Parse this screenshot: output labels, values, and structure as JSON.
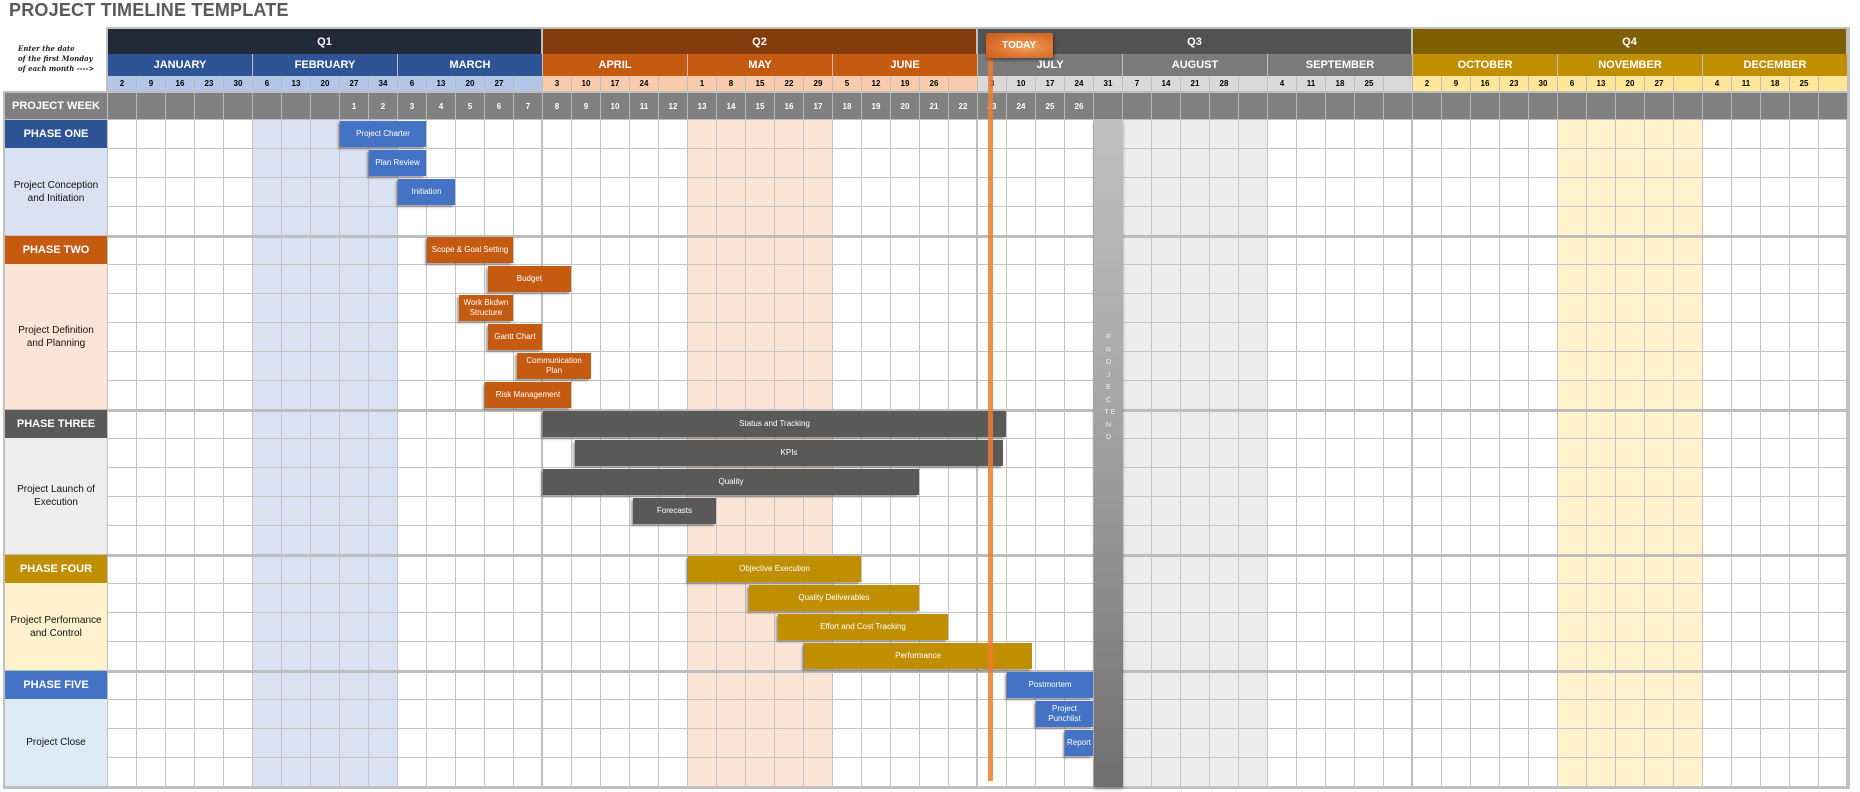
{
  "title": "PROJECT TIMELINE TEMPLATE",
  "note": "Enter the date\nof the first Monday\nof each month ---->",
  "project_week_label": "PROJECT WEEK",
  "today_label": "TODAY",
  "today_week_index": 30.4,
  "project_end_label": "PROJECT END",
  "project_end_week_index": 34,
  "quarters": [
    {
      "label": "Q1",
      "dark": "#222a38",
      "month_color": "#2f5496",
      "date_color": "#b4c6e7",
      "shade": "#dae1f2",
      "shade_month": 1,
      "months": [
        {
          "label": "JANUARY",
          "dates": [
            "2",
            "9",
            "16",
            "23",
            "30"
          ]
        },
        {
          "label": "FEBRUARY",
          "dates": [
            "6",
            "13",
            "20",
            "27",
            "34"
          ]
        },
        {
          "label": "MARCH",
          "dates": [
            "6",
            "13",
            "20",
            "27",
            ""
          ]
        }
      ]
    },
    {
      "label": "Q2",
      "dark": "#843c0c",
      "month_color": "#c55a11",
      "date_color": "#f8cbad",
      "shade": "#fce4d6",
      "shade_month": 1,
      "months": [
        {
          "label": "APRIL",
          "dates": [
            "3",
            "10",
            "17",
            "24",
            ""
          ]
        },
        {
          "label": "MAY",
          "dates": [
            "1",
            "8",
            "15",
            "22",
            "29"
          ]
        },
        {
          "label": "JUNE",
          "dates": [
            "5",
            "12",
            "19",
            "26",
            ""
          ]
        }
      ]
    },
    {
      "label": "Q3",
      "dark": "#525252",
      "month_color": "#7b7b7b",
      "date_color": "#d9d9d9",
      "shade": "#ececec",
      "shade_month": 1,
      "months": [
        {
          "label": "JULY",
          "dates": [
            "3",
            "10",
            "17",
            "24",
            "31"
          ]
        },
        {
          "label": "AUGUST",
          "dates": [
            "7",
            "14",
            "21",
            "28",
            ""
          ]
        },
        {
          "label": "SEPTEMBER",
          "dates": [
            "4",
            "11",
            "18",
            "25",
            ""
          ]
        }
      ]
    },
    {
      "label": "Q4",
      "dark": "#7f6000",
      "month_color": "#bf8f00",
      "date_color": "#ffe699",
      "shade": "#fff2cc",
      "shade_month": 1,
      "months": [
        {
          "label": "OCTOBER",
          "dates": [
            "2",
            "9",
            "16",
            "23",
            "30"
          ]
        },
        {
          "label": "NOVEMBER",
          "dates": [
            "6",
            "13",
            "20",
            "27",
            ""
          ]
        },
        {
          "label": "DECEMBER",
          "dates": [
            "4",
            "11",
            "18",
            "25",
            ""
          ]
        }
      ]
    }
  ],
  "project_weeks": [
    "",
    "",
    "",
    "",
    "",
    "",
    "",
    "",
    "1",
    "2",
    "3",
    "4",
    "5",
    "6",
    "7",
    "8",
    "9",
    "10",
    "11",
    "12",
    "13",
    "14",
    "15",
    "16",
    "17",
    "18",
    "19",
    "20",
    "21",
    "22",
    "23",
    "24",
    "25",
    "26",
    "",
    "",
    "",
    "",
    "",
    "",
    "",
    "",
    "",
    "",
    "",
    "",
    "",
    "",
    "",
    "",
    "",
    "",
    "",
    "",
    "",
    "",
    "",
    "",
    "",
    ""
  ],
  "phases": [
    {
      "label": "PHASE ONE",
      "description": "Project Conception and Initiation",
      "head_color": "#2f5496",
      "desc_bg": "#dae1f2",
      "bar_color": "#4472c4",
      "rows": 4,
      "tasks": [
        {
          "name": "Project Charter",
          "row": 0,
          "start": 8,
          "end": 11
        },
        {
          "name": "Plan Review",
          "row": 1,
          "start": 9,
          "end": 11
        },
        {
          "name": "Initiation",
          "row": 2,
          "start": 10,
          "end": 12
        }
      ]
    },
    {
      "label": "PHASE TWO",
      "description": "Project Definition and Planning",
      "head_color": "#c55a11",
      "desc_bg": "#fce4d6",
      "bar_color": "#c55a11",
      "rows": 6,
      "tasks": [
        {
          "name": "Scope & Goal Setting",
          "row": 0,
          "start": 11,
          "end": 14
        },
        {
          "name": "Budget",
          "row": 1,
          "start": 13.1,
          "end": 16
        },
        {
          "name": "Work Bkdwn Structure",
          "row": 2,
          "start": 12.1,
          "end": 14
        },
        {
          "name": "Gantt Chart",
          "row": 3,
          "start": 13.1,
          "end": 15
        },
        {
          "name": "Communication Plan",
          "row": 4,
          "start": 14.1,
          "end": 16.7
        },
        {
          "name": "Risk Management",
          "row": 5,
          "start": 13,
          "end": 16
        }
      ]
    },
    {
      "label": "PHASE THREE",
      "description": "Project Launch of Execution",
      "head_color": "#595959",
      "desc_bg": "#ededed",
      "bar_color": "#595959",
      "rows": 5,
      "tasks": [
        {
          "name": "Status  and Tracking",
          "row": 0,
          "start": 15,
          "end": 31
        },
        {
          "name": "KPIs",
          "row": 1,
          "start": 16.1,
          "end": 30.9
        },
        {
          "name": "Quality",
          "row": 2,
          "start": 15,
          "end": 28
        },
        {
          "name": "Forecasts",
          "row": 3,
          "start": 18.1,
          "end": 21
        }
      ]
    },
    {
      "label": "PHASE FOUR",
      "description": "Project Performance and Control",
      "head_color": "#bf8f00",
      "desc_bg": "#fff2cc",
      "bar_color": "#bf8f00",
      "rows": 4,
      "tasks": [
        {
          "name": "Objective Execution",
          "row": 0,
          "start": 20,
          "end": 26
        },
        {
          "name": "Quality Deliverables",
          "row": 1,
          "start": 22.1,
          "end": 28
        },
        {
          "name": "Effort and Cost Tracking",
          "row": 2,
          "start": 23.1,
          "end": 29
        },
        {
          "name": "Performance",
          "row": 3,
          "start": 24,
          "end": 31.9
        }
      ]
    },
    {
      "label": "PHASE FIVE",
      "description": "Project Close",
      "head_color": "#4472c4",
      "desc_bg": "#ddebf7",
      "bar_color": "#4472c4",
      "rows": 4,
      "tasks": [
        {
          "name": "Postmortem",
          "row": 0,
          "start": 31,
          "end": 34
        },
        {
          "name": "Project Punchlist",
          "row": 1,
          "start": 32,
          "end": 34
        },
        {
          "name": "Report",
          "row": 2,
          "start": 33,
          "end": 34
        }
      ]
    }
  ]
}
